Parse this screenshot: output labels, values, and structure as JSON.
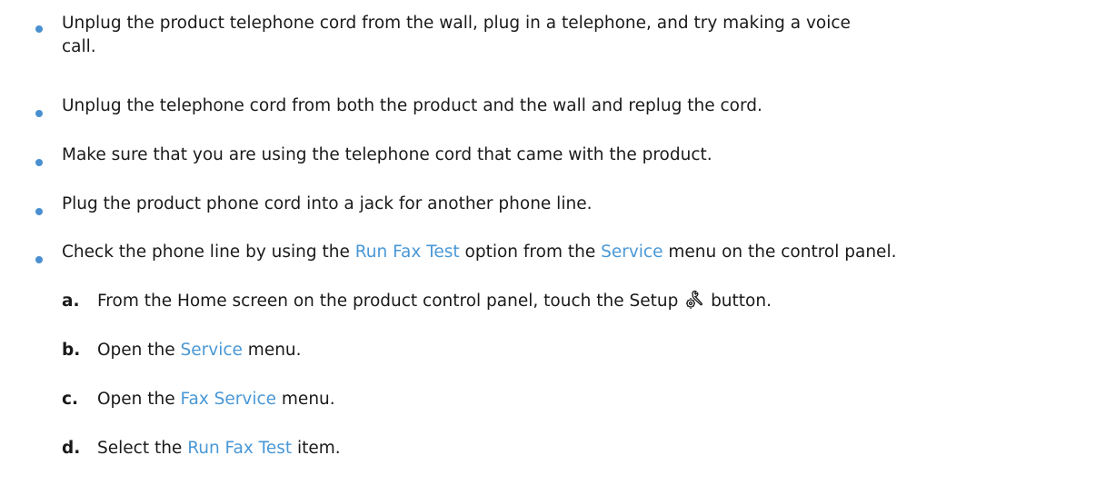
{
  "colors": {
    "bullet": "#4a90d0",
    "link": "#4a98d6",
    "text": "#1a1a1a"
  },
  "bullets": [
    {
      "line1": "Unplug the product telephone cord from the wall, plug in a telephone, and try making a voice",
      "line2": "call."
    },
    {
      "text": "Unplug the telephone cord from both the product and the wall and replug the cord."
    },
    {
      "text": "Make sure that you are using the telephone cord that came with the product."
    },
    {
      "text": "Plug the product phone cord into a jack for another phone line."
    },
    {
      "before": "Check the phone line by using the ",
      "link1": "Run Fax Test",
      "middle": " option from the ",
      "link2": "Service",
      "after": " menu on the control panel."
    }
  ],
  "steps": [
    {
      "marker": "a.",
      "before": "From the Home screen on the product control panel, touch the Setup ",
      "icon": "setup-wrench-gear-icon",
      "after": " button."
    },
    {
      "marker": "b.",
      "before": "Open the ",
      "link": "Service",
      "after": " menu."
    },
    {
      "marker": "c.",
      "before": "Open the ",
      "link": "Fax Service",
      "after": " menu."
    },
    {
      "marker": "d.",
      "before": "Select the ",
      "link": "Run Fax Test",
      "after": " item."
    }
  ]
}
